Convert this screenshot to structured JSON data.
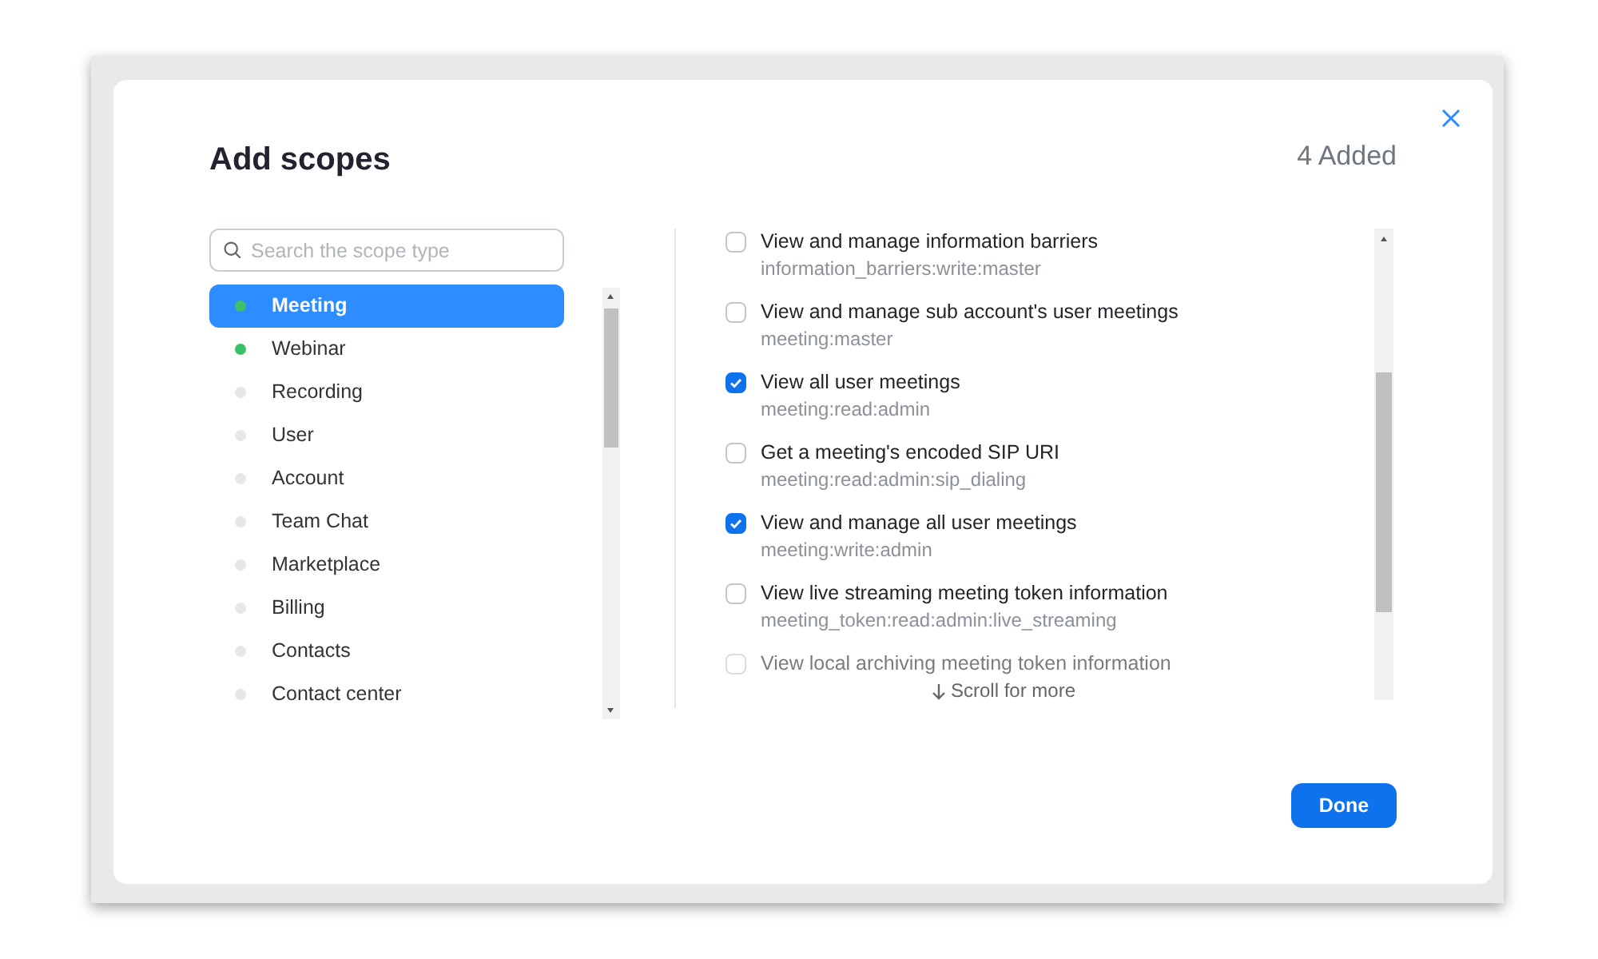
{
  "dialog": {
    "title": "Add scopes",
    "added_count": "4 Added"
  },
  "search": {
    "placeholder": "Search the scope type"
  },
  "scope_types": [
    {
      "label": "Meeting",
      "color": "#3cc06a",
      "selected": true
    },
    {
      "label": "Webinar",
      "color": "#3cc06a",
      "selected": false
    },
    {
      "label": "Recording",
      "color": "#e6e7eb",
      "selected": false
    },
    {
      "label": "User",
      "color": "#e6e7eb",
      "selected": false
    },
    {
      "label": "Account",
      "color": "#e6e7eb",
      "selected": false
    },
    {
      "label": "Team Chat",
      "color": "#e6e7eb",
      "selected": false
    },
    {
      "label": "Marketplace",
      "color": "#e6e7eb",
      "selected": false
    },
    {
      "label": "Billing",
      "color": "#e6e7eb",
      "selected": false
    },
    {
      "label": "Contacts",
      "color": "#e6e7eb",
      "selected": false
    },
    {
      "label": "Contact center",
      "color": "#e6e7eb",
      "selected": false
    }
  ],
  "scopes": [
    {
      "title": "View and manage information barriers",
      "code": "information_barriers:write:master",
      "checked": false
    },
    {
      "title": "View and manage sub account's user meetings",
      "code": "meeting:master",
      "checked": false
    },
    {
      "title": "View all user meetings",
      "code": "meeting:read:admin",
      "checked": true
    },
    {
      "title": "Get a meeting's encoded SIP URI",
      "code": "meeting:read:admin:sip_dialing",
      "checked": false
    },
    {
      "title": "View and manage all user meetings",
      "code": "meeting:write:admin",
      "checked": true
    },
    {
      "title": "View live streaming meeting token information",
      "code": "meeting_token:read:admin:live_streaming",
      "checked": false
    },
    {
      "title": "View local archiving meeting token information",
      "checked": false
    }
  ],
  "scroll_hint": "Scroll for more",
  "done_button": "Done"
}
